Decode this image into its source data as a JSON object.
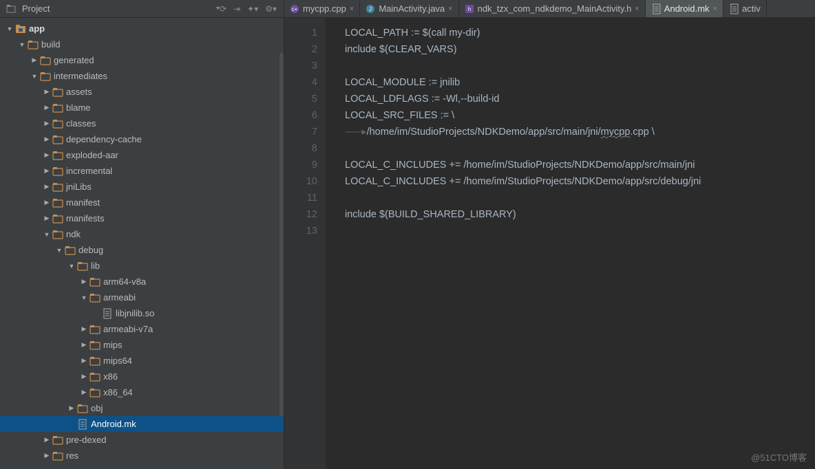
{
  "sidebar": {
    "title": "Project",
    "toolbar": {
      "i1": "⟳",
      "i2": "⇥",
      "i3": "✦▾",
      "i4": "⚙▾"
    },
    "tree": [
      {
        "depth": 0,
        "expand": "down",
        "icon": "module",
        "label": "app",
        "bold": true
      },
      {
        "depth": 1,
        "expand": "down",
        "icon": "folder",
        "label": "build"
      },
      {
        "depth": 2,
        "expand": "right",
        "icon": "folder",
        "label": "generated"
      },
      {
        "depth": 2,
        "expand": "down",
        "icon": "folder",
        "label": "intermediates"
      },
      {
        "depth": 3,
        "expand": "right",
        "icon": "folder",
        "label": "assets"
      },
      {
        "depth": 3,
        "expand": "right",
        "icon": "folder",
        "label": "blame"
      },
      {
        "depth": 3,
        "expand": "right",
        "icon": "folder",
        "label": "classes"
      },
      {
        "depth": 3,
        "expand": "right",
        "icon": "folder",
        "label": "dependency-cache"
      },
      {
        "depth": 3,
        "expand": "right",
        "icon": "folder",
        "label": "exploded-aar"
      },
      {
        "depth": 3,
        "expand": "right",
        "icon": "folder",
        "label": "incremental"
      },
      {
        "depth": 3,
        "expand": "right",
        "icon": "folder",
        "label": "jniLibs"
      },
      {
        "depth": 3,
        "expand": "right",
        "icon": "folder",
        "label": "manifest"
      },
      {
        "depth": 3,
        "expand": "right",
        "icon": "folder",
        "label": "manifests"
      },
      {
        "depth": 3,
        "expand": "down",
        "icon": "folder",
        "label": "ndk"
      },
      {
        "depth": 4,
        "expand": "down",
        "icon": "folder",
        "label": "debug"
      },
      {
        "depth": 5,
        "expand": "down",
        "icon": "folder",
        "label": "lib"
      },
      {
        "depth": 6,
        "expand": "right",
        "icon": "folder",
        "label": "arm64-v8a"
      },
      {
        "depth": 6,
        "expand": "down",
        "icon": "folder",
        "label": "armeabi"
      },
      {
        "depth": 7,
        "expand": "",
        "icon": "file",
        "label": "libjnilib.so"
      },
      {
        "depth": 6,
        "expand": "right",
        "icon": "folder",
        "label": "armeabi-v7a"
      },
      {
        "depth": 6,
        "expand": "right",
        "icon": "folder",
        "label": "mips"
      },
      {
        "depth": 6,
        "expand": "right",
        "icon": "folder",
        "label": "mips64"
      },
      {
        "depth": 6,
        "expand": "right",
        "icon": "folder",
        "label": "x86"
      },
      {
        "depth": 6,
        "expand": "right",
        "icon": "folder",
        "label": "x86_64"
      },
      {
        "depth": 5,
        "expand": "right",
        "icon": "folder",
        "label": "obj"
      },
      {
        "depth": 5,
        "expand": "",
        "icon": "file",
        "label": "Android.mk",
        "selected": true
      },
      {
        "depth": 3,
        "expand": "right",
        "icon": "folder",
        "label": "pre-dexed"
      },
      {
        "depth": 3,
        "expand": "right",
        "icon": "folder",
        "label": "res"
      }
    ]
  },
  "tabs": [
    {
      "icon": "cpp",
      "label": "mycpp.cpp",
      "active": false
    },
    {
      "icon": "java",
      "label": "MainActivity.java",
      "active": false
    },
    {
      "icon": "h",
      "label": "ndk_tzx_com_ndkdemo_MainActivity.h",
      "active": false
    },
    {
      "icon": "file",
      "label": "Android.mk",
      "active": true
    },
    {
      "icon": "file",
      "label": "activ",
      "active": false,
      "overflow": true
    }
  ],
  "code": {
    "lines": [
      "LOCAL_PATH := $(call my-dir)",
      "include $(CLEAR_VARS)",
      "",
      "LOCAL_MODULE := jnilib",
      "LOCAL_LDFLAGS := -Wl,--build-id",
      "LOCAL_SRC_FILES := \\",
      "⟶/home/im/StudioProjects/NDKDemo/app/src/main/jni/mycpp.cpp \\",
      "",
      "LOCAL_C_INCLUDES += /home/im/StudioProjects/NDKDemo/app/src/main/jni",
      "LOCAL_C_INCLUDES += /home/im/StudioProjects/NDKDemo/app/src/debug/jni",
      "",
      "include $(BUILD_SHARED_LIBRARY)",
      ""
    ],
    "warn_token": "mycpp"
  },
  "watermark": "@51CTO博客"
}
